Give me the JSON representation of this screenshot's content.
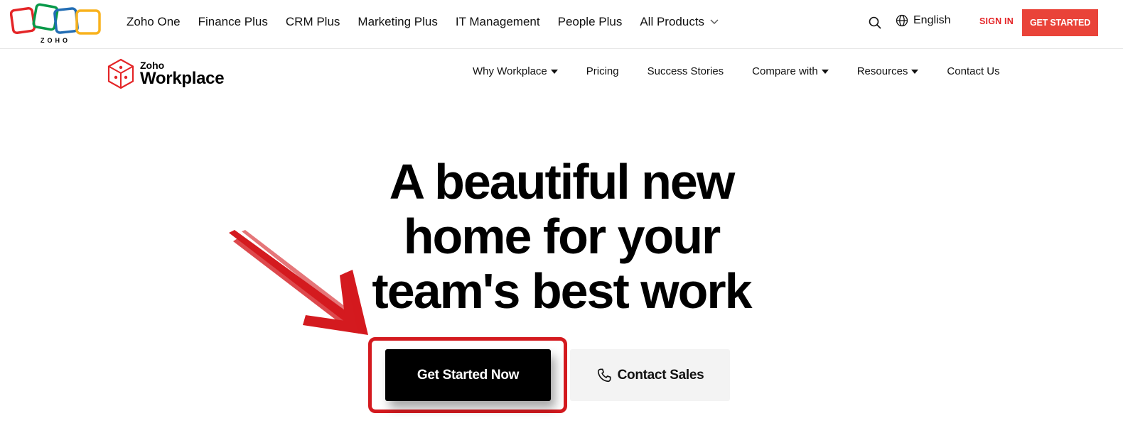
{
  "topbar": {
    "logo_text": "ZOHO",
    "nav": [
      "Zoho One",
      "Finance Plus",
      "CRM Plus",
      "Marketing Plus",
      "IT Management",
      "People Plus",
      "All Products"
    ],
    "language": "English",
    "signin": "SIGN IN",
    "get_started": "GET STARTED"
  },
  "product": {
    "brand_small": "Zoho",
    "brand_big": "Workplace"
  },
  "secnav": [
    "Why Workplace",
    "Pricing",
    "Success Stories",
    "Compare with",
    "Resources",
    "Contact Us"
  ],
  "hero": {
    "line1": "A beautiful new",
    "line2": "home for your",
    "line3": "team's best work"
  },
  "cta": {
    "primary": "Get Started Now",
    "secondary": "Contact Sales"
  },
  "colors": {
    "accent_red": "#e94339",
    "annotation_red": "#d41a1f",
    "zoho_red": "#e42527",
    "zoho_green": "#089949",
    "zoho_blue": "#226db4",
    "zoho_yellow": "#f9b21d"
  },
  "icons": {
    "search": "search-icon",
    "language": "globe-icon",
    "phone": "phone-icon",
    "chevron": "chevron-down-icon",
    "caret": "caret-down-icon",
    "workplace": "workplace-cube-icon",
    "annotation": "red-arrow-annotation"
  }
}
